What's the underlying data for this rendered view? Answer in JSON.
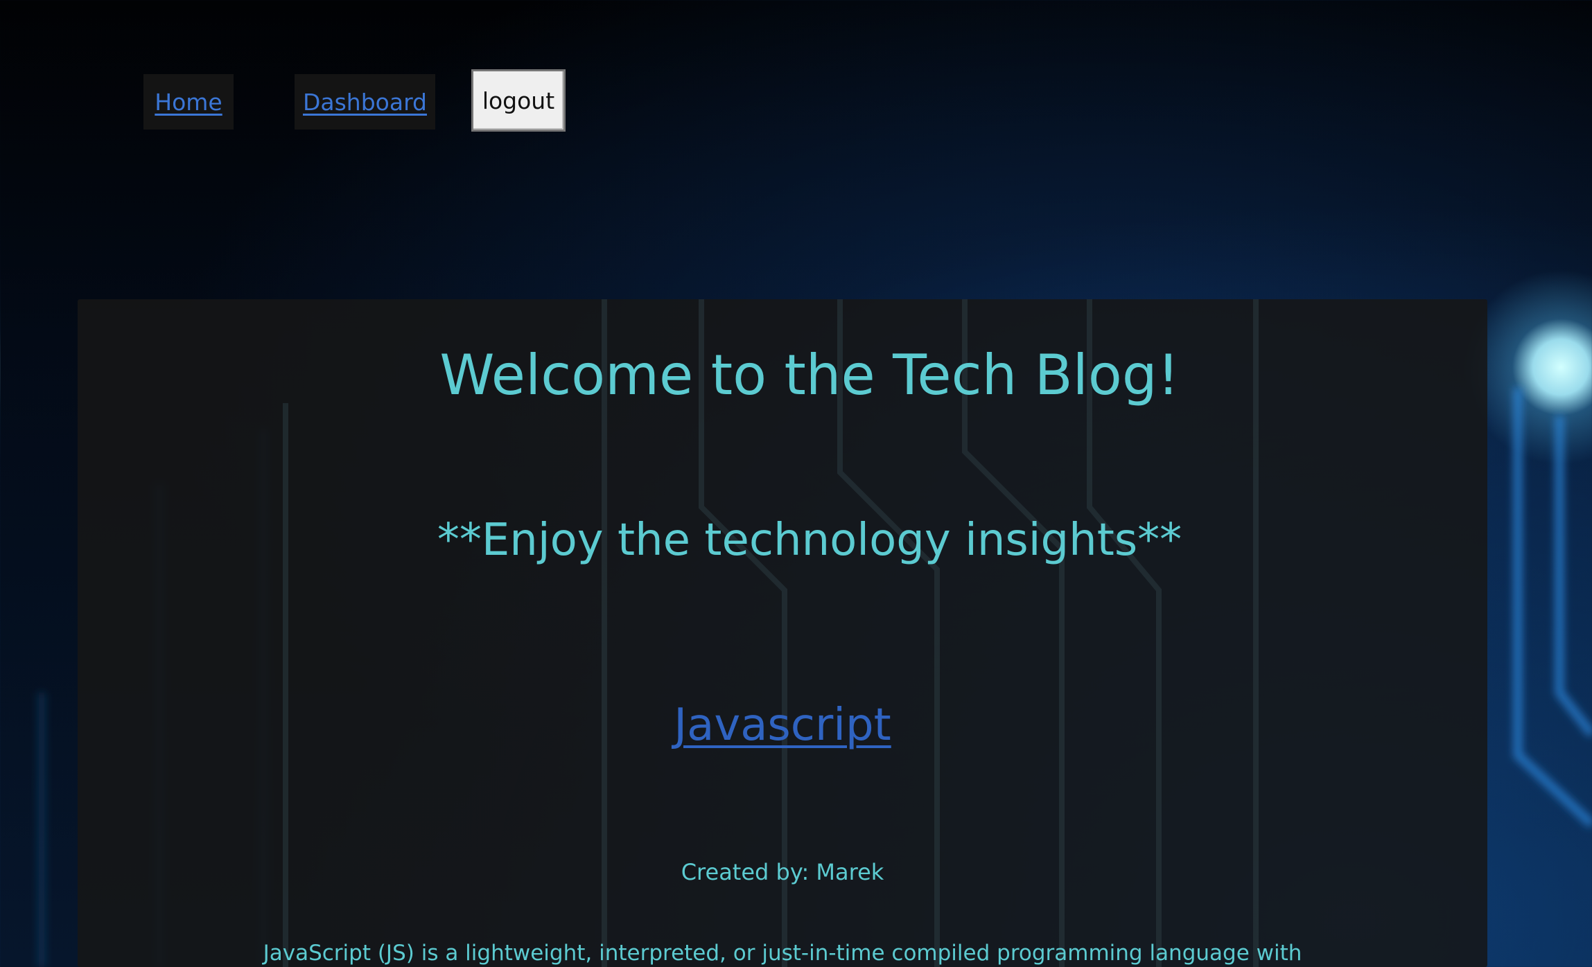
{
  "nav": {
    "home_label": "Home",
    "dashboard_label": "Dashboard",
    "logout_label": "logout"
  },
  "main": {
    "welcome_title": "Welcome to the Tech Blog!",
    "subtitle": "**Enjoy the technology insights**",
    "post": {
      "title": "Javascript",
      "author": "Created by: Marek",
      "excerpt": "JavaScript (JS) is a lightweight, interpreted, or just-in-time compiled programming language with"
    }
  },
  "colors": {
    "accent_text": "#5ccbd1",
    "link": "#3b76d6",
    "panel_bg": "#161616"
  },
  "background": {
    "description_icon": "circuit-board-background"
  }
}
